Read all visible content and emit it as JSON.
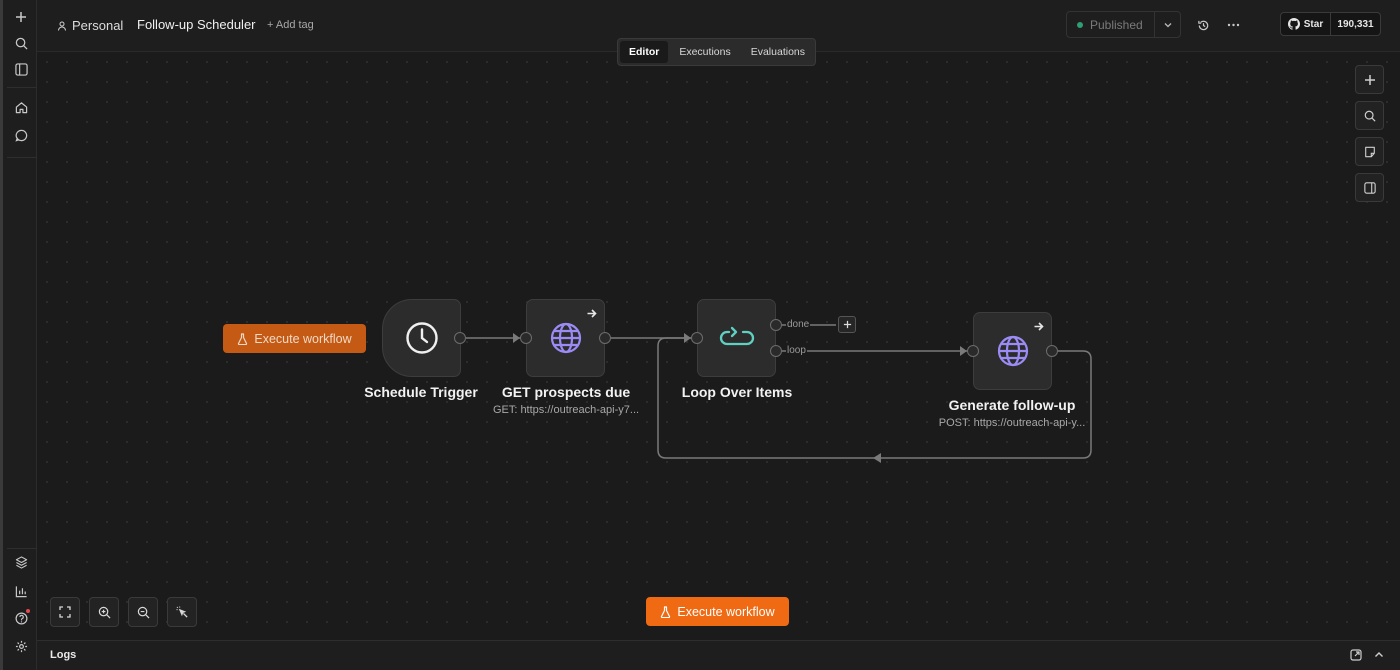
{
  "header": {
    "project": "Personal",
    "workflow_title": "Follow-up Scheduler",
    "add_tag": "+ Add tag",
    "publish_status": "Published",
    "github_star": "Star",
    "github_count": "190,331"
  },
  "tabs": [
    {
      "label": "Editor",
      "active": true
    },
    {
      "label": "Executions",
      "active": false
    },
    {
      "label": "Evaluations",
      "active": false
    }
  ],
  "nodes": {
    "schedule": {
      "label": "Schedule Trigger",
      "icon": "clock-icon"
    },
    "get_prospects": {
      "label": "GET prospects due",
      "subtitle": "GET: https://outreach-api-y7...",
      "icon": "globe-icon"
    },
    "loop": {
      "label": "Loop Over Items",
      "icon": "loop-arrow-icon",
      "outputs": {
        "done": "done",
        "loop": "loop"
      }
    },
    "generate": {
      "label": "Generate follow-up",
      "subtitle": "POST: https://outreach-api-y...",
      "icon": "globe-icon"
    }
  },
  "execute": {
    "inline_label": "Execute workflow",
    "bottom_label": "Execute workflow"
  },
  "logs": {
    "label": "Logs"
  },
  "colors": {
    "accent_orange": "#ef6a13",
    "published_dot": "#2f9e74",
    "icon_purple": "#9b8cf5",
    "loop_teal": "#5fd0c2",
    "canvas_bg": "#1b1b1b"
  }
}
